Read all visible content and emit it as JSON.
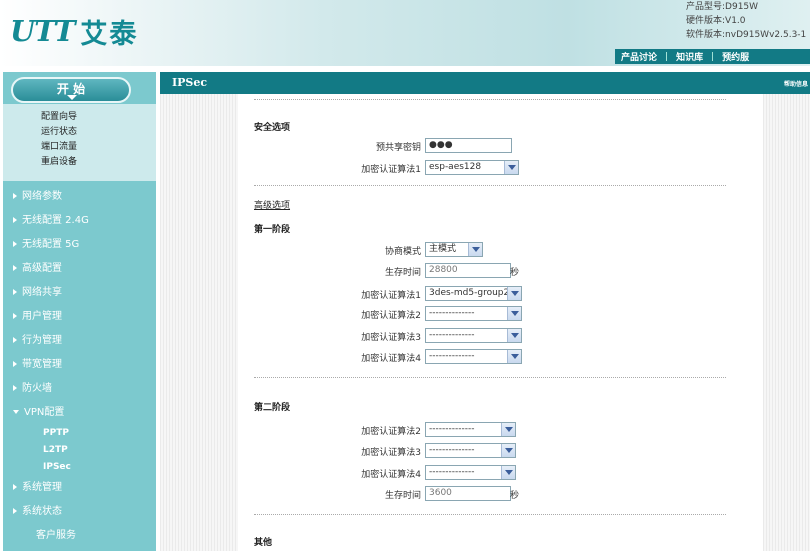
{
  "header": {
    "logo_mark": "UTT",
    "logo_cn": "艾泰",
    "version_lines": [
      "产品型号:D915W",
      "硬件版本:V1.0",
      "软件版本:nvD915Wv2.5.3-1"
    ],
    "nav": [
      "产品讨论",
      "知识库",
      "预约服"
    ]
  },
  "sidebar": {
    "start_label": "开 始",
    "quick_links": [
      "配置向导",
      "运行状态",
      "端口流量",
      "重启设备"
    ],
    "menu": [
      "网络参数",
      "无线配置 2.4G",
      "无线配置 5G",
      "高级配置",
      "网络共享",
      "用户管理",
      "行为管理",
      "带宽管理",
      "防火墙",
      "VPN配置"
    ],
    "vpn_sub": [
      "PPTP",
      "L2TP",
      "IPSec"
    ],
    "menu_after": [
      "系统管理",
      "系统状态"
    ],
    "service": "客户服务"
  },
  "main": {
    "title": "IPSec",
    "help": "帮助信息",
    "security": {
      "heading": "安全选项",
      "psk_label": "预共享密钥",
      "psk_value": "●●●",
      "enc1_label": "加密认证算法1",
      "enc1_value": "esp-aes128"
    },
    "advanced_link": "高级选项",
    "phase1": {
      "heading": "第一阶段",
      "mode_label": "协商模式",
      "mode_value": "主模式",
      "lifetime_label": "生存时间",
      "lifetime_value": "28800",
      "lifetime_unit": "秒",
      "enc1_label": "加密认证算法1",
      "enc1_value": "3des-md5-group2",
      "enc2_label": "加密认证算法2",
      "enc2_value": "--------------",
      "enc3_label": "加密认证算法3",
      "enc3_value": "--------------",
      "enc4_label": "加密认证算法4",
      "enc4_value": "--------------"
    },
    "phase2": {
      "heading": "第二阶段",
      "enc2_label": "加密认证算法2",
      "enc2_value": "--------------",
      "enc3_label": "加密认证算法3",
      "enc3_value": "--------------",
      "enc4_label": "加密认证算法4",
      "enc4_value": "--------------",
      "lifetime_label": "生存时间",
      "lifetime_value": "3600",
      "lifetime_unit": "秒"
    },
    "other_heading": "其他"
  },
  "colors": {
    "brand": "#148a94",
    "header_bar": "#127a85",
    "sidebar": "#7cc9ce"
  }
}
